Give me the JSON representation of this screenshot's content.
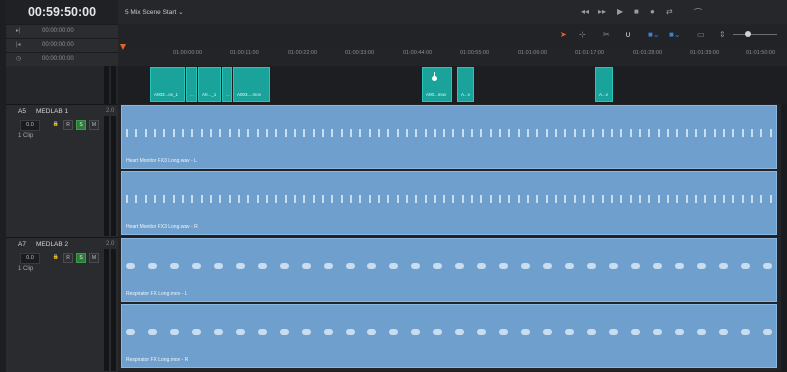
{
  "timecode": {
    "main": "00:59:50:00",
    "rows": [
      {
        "icon": "▸|",
        "value": "00:00:00:00"
      },
      {
        "icon": "|◂",
        "value": "00:00:00:00"
      },
      {
        "icon": "◷",
        "value": "00:00:00:00"
      }
    ]
  },
  "header": {
    "scene": "5 Mix Scene Start ⌄"
  },
  "transport": [
    "◂◂",
    "▸▸",
    "▶",
    "■",
    "●",
    "⇄",
    "⌒"
  ],
  "toolbar": [
    "➤",
    "⊹",
    "✂",
    "∪",
    "■⌄",
    "■⌄",
    "▭",
    "⇕"
  ],
  "ruler": [
    "01:00:00:00",
    "01:00:11:00",
    "01:00:22:00",
    "01:00:33:00",
    "01:00:44:00",
    "01:00:55:00",
    "01:01:06:00",
    "01:01:17:00",
    "01:01:28:00",
    "01:01:39:00",
    "01:01:50:00"
  ],
  "video_clips": [
    "A003...ov_1",
    "...",
    "A0..._1",
    "...",
    "A003....mov",
    "A00...mov",
    "A...v",
    "A...v"
  ],
  "tracks": [
    {
      "id": "A5",
      "name": "MEDLAB 1",
      "channel": "2.0",
      "volume": "0.0",
      "clips": "1 Clip",
      "buttons": [
        "🔒",
        "R",
        "S",
        "M"
      ],
      "lanes": [
        "Heart Monitor FX3 Long.wav - L",
        "Heart Monitor FX3 Long.wav - R"
      ]
    },
    {
      "id": "A7",
      "name": "MEDLAB 2",
      "channel": "2.0",
      "volume": "0.0",
      "clips": "1 Clip",
      "buttons": [
        "🔒",
        "R",
        "S",
        "M"
      ],
      "lanes": [
        "Respirator FX Long.mov - L",
        "Respirator FX Long.mov - R"
      ]
    }
  ],
  "colors": {
    "video_clip": "#1aa39b",
    "audio_clip": "#6f9fcc",
    "playhead": "#e0642a"
  }
}
